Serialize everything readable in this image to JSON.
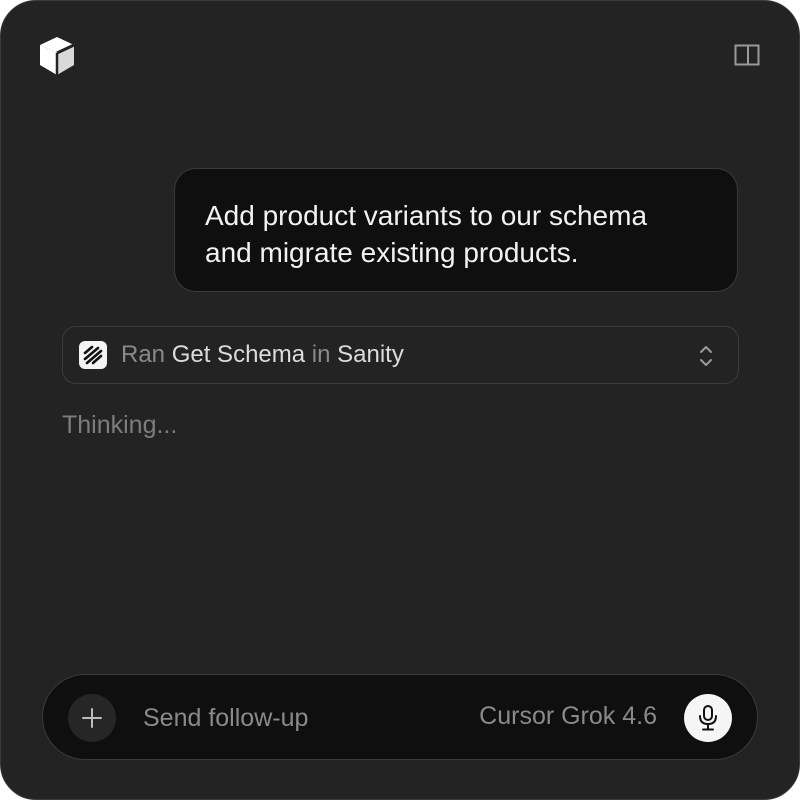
{
  "header": {
    "logo_icon": "cube-logo-icon",
    "panel_toggle_icon": "sidebar-panel-icon"
  },
  "conversation": {
    "user_message_line1": "Add product variants to our schema",
    "user_message_line2": "and migrate existing products.",
    "tool_call": {
      "icon": "sanity-logo-icon",
      "verb": "Ran",
      "tool": "Get Schema",
      "connector": "in",
      "source": "Sanity",
      "expand_icon": "chevron-up-down-icon"
    },
    "status": "Thinking..."
  },
  "composer": {
    "add_icon": "plus-icon",
    "placeholder": "Send follow-up",
    "value": "",
    "model": "Cursor Grok 4.6",
    "mic_icon": "microphone-icon"
  },
  "colors": {
    "window_bg": "#232323",
    "bubble_bg": "#0f0f0f",
    "border": "#3a3a3a",
    "text_primary": "#f2f2f2",
    "text_muted": "#8a8a8a",
    "mic_bg": "#f5f5f5"
  }
}
